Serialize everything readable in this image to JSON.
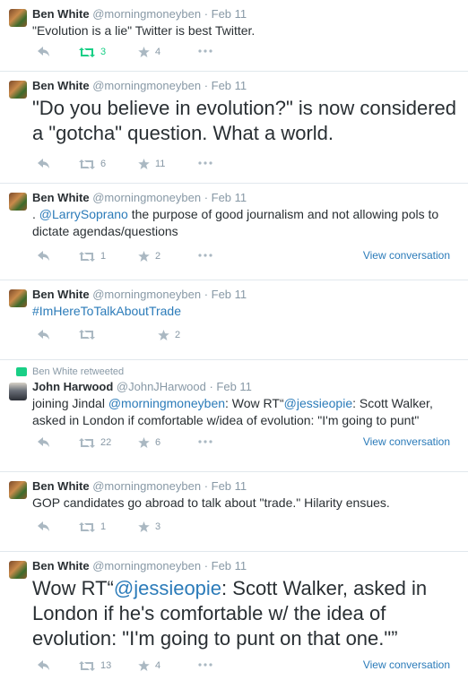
{
  "tweets": [
    {
      "fullname": "Ben White",
      "username": "@morningmoneyben",
      "time": "· Feb 11",
      "text": "\"Evolution is a lie\" Twitter is best Twitter.",
      "retweets": "3",
      "favorites": "4"
    },
    {
      "fullname": "Ben White",
      "username": "@morningmoneyben",
      "time": "· Feb 11",
      "text": "\"Do you believe in evolution?\" is now considered a \"gotcha\" question. What a world.",
      "retweets": "6",
      "favorites": "11"
    },
    {
      "fullname": "Ben White",
      "username": "@morningmoneyben",
      "time": "· Feb 11",
      "text_prefix": ". ",
      "mention": "@LarrySoprano",
      "text_suffix": " the purpose of good journalism and not allowing pols to dictate agendas/questions",
      "retweets": "1",
      "favorites": "2",
      "view_conversation": "View conversation"
    },
    {
      "fullname": "Ben White",
      "username": "@morningmoneyben",
      "time": "· Feb 11",
      "hashtag": "#ImHereToTalkAboutTrade",
      "favorites": "2"
    },
    {
      "retweeted_by": "Ben White retweeted",
      "fullname": "John Harwood",
      "username": "@JohnJHarwood",
      "time": "· Feb 11",
      "text_a": "joining Jindal ",
      "mention_a": "@morningmoneyben",
      "text_b": ": Wow RT“",
      "mention_b": "@jessieopie",
      "text_c": ": Scott Walker, asked in London if comfortable w/idea of evolution: \"I'm going to punt\"",
      "retweets": "22",
      "favorites": "6",
      "view_conversation": "View conversation"
    },
    {
      "fullname": "Ben White",
      "username": "@morningmoneyben",
      "time": "· Feb 11",
      "text": "GOP candidates go abroad to talk about \"trade.\" Hilarity ensues.",
      "retweets": "1",
      "favorites": "3"
    },
    {
      "fullname": "Ben White",
      "username": "@morningmoneyben",
      "time": "· Feb 11",
      "text_a": "Wow RT“",
      "mention": "@jessieopie",
      "text_b": ": Scott Walker, asked in London if he's comfortable w/ the idea of evolution: \"I'm going to punt on that one.\"”",
      "retweets": "13",
      "favorites": "4",
      "view_conversation": "View conversation"
    }
  ],
  "colors": {
    "link": "#2b7bb9",
    "retweet_active": "#19cf86",
    "muted": "#8899a6",
    "divider": "#e1e8ed"
  },
  "icons": [
    "reply-icon",
    "retweet-icon",
    "favorite-icon",
    "more-icon",
    "retweet-context-icon"
  ]
}
